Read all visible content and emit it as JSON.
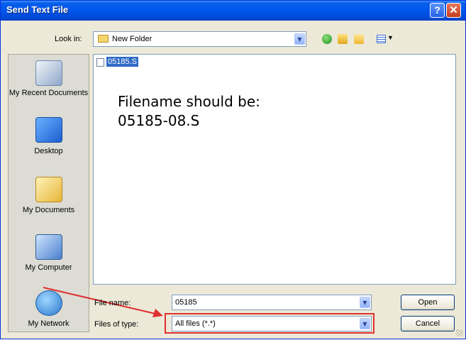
{
  "window": {
    "title": "Send Text File",
    "help_glyph": "?",
    "close_glyph": "✕"
  },
  "toolbar": {
    "look_in_label": "Look in:",
    "look_in_value": "New Folder"
  },
  "places": [
    "My Recent Documents",
    "Desktop",
    "My Documents",
    "My Computer",
    "My Network"
  ],
  "files": [
    {
      "name": "05185.S",
      "selected": true
    }
  ],
  "annotation": {
    "line1": "Filename should be:",
    "line2": "05185-08.S",
    "highlight_color": "#e03030"
  },
  "form": {
    "filename_label": "File name:",
    "filename_value": "05185",
    "filetype_label": "Files of type:",
    "filetype_value": "All files (*.*)"
  },
  "buttons": {
    "open": "Open",
    "cancel": "Cancel"
  }
}
